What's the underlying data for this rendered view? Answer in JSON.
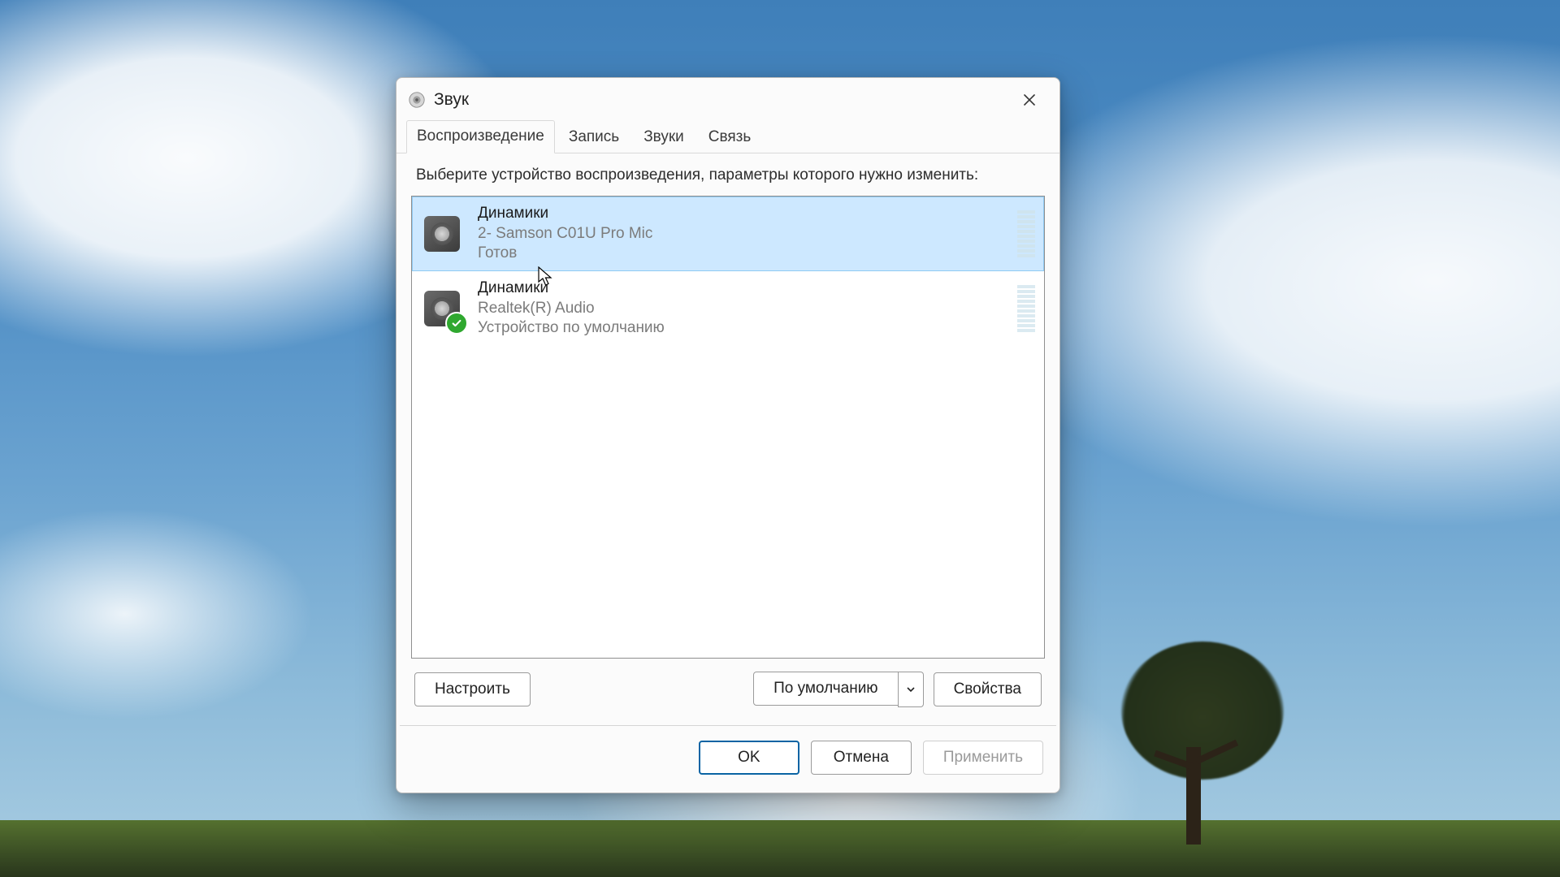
{
  "window": {
    "title": "Звук"
  },
  "tabs": [
    {
      "label": "Воспроизведение",
      "active": true
    },
    {
      "label": "Запись",
      "active": false
    },
    {
      "label": "Звуки",
      "active": false
    },
    {
      "label": "Связь",
      "active": false
    }
  ],
  "instruction": "Выберите устройство воспроизведения, параметры которого нужно изменить:",
  "devices": [
    {
      "title": "Динамики",
      "subtitle": "2- Samson C01U Pro Mic",
      "status": "Готов",
      "selected": true,
      "is_default": false
    },
    {
      "title": "Динамики",
      "subtitle": "Realtek(R) Audio",
      "status": "Устройство по умолчанию",
      "selected": false,
      "is_default": true
    }
  ],
  "buttons": {
    "configure": "Настроить",
    "set_default": "По умолчанию",
    "properties": "Свойства",
    "ok": "OK",
    "cancel": "Отмена",
    "apply": "Применить"
  }
}
